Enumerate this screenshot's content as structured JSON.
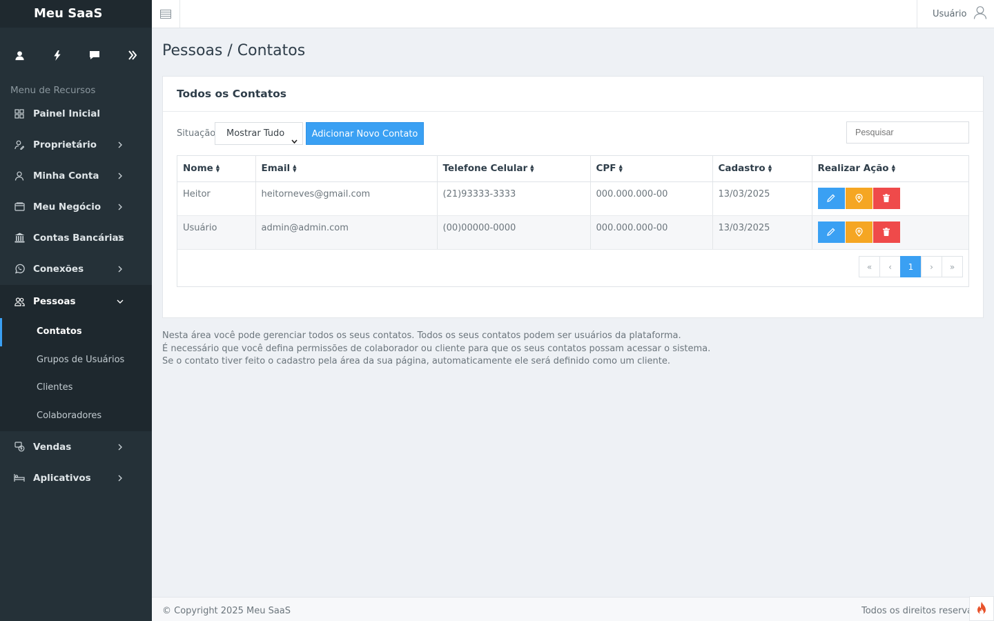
{
  "brand": "Meu SaaS",
  "sidebar": {
    "section_label": "Menu de Recursos",
    "items": [
      {
        "label": "Painel Inicial"
      },
      {
        "label": "Proprietário"
      },
      {
        "label": "Minha Conta"
      },
      {
        "label": "Meu Negócio"
      },
      {
        "label": "Contas Bancárias"
      },
      {
        "label": "Conexões"
      },
      {
        "label": "Pessoas"
      },
      {
        "label": "Vendas"
      },
      {
        "label": "Aplicativos"
      }
    ],
    "submenu": [
      {
        "label": "Contatos"
      },
      {
        "label": "Grupos de Usuários"
      },
      {
        "label": "Clientes"
      },
      {
        "label": "Colaboradores"
      }
    ]
  },
  "topbar": {
    "user_label": "Usuário"
  },
  "page": {
    "title": "Pessoas / Contatos",
    "card_title": "Todos os Contatos",
    "filter_label": "Situação",
    "filter_value": "Mostrar Tudo",
    "add_button": "Adicionar Novo Contato",
    "search_placeholder": "Pesquisar"
  },
  "table": {
    "columns": [
      "Nome",
      "Email",
      "Telefone Celular",
      "CPF",
      "Cadastro",
      "Realizar Ação"
    ],
    "rows": [
      {
        "nome": "Heitor",
        "email": "heitorneves@gmail.com",
        "telefone": "(21)93333-3333",
        "cpf": "000.000.000-00",
        "cadastro": "13/03/2025"
      },
      {
        "nome": "Usuário",
        "email": "admin@admin.com",
        "telefone": "(00)00000-0000",
        "cpf": "000.000.000-00",
        "cadastro": "13/03/2025"
      }
    ]
  },
  "pagination": {
    "first": "«",
    "prev": "‹",
    "current": "1",
    "next": "›",
    "last": "»"
  },
  "info_lines": [
    "Nesta área você pode gerenciar todos os seus contatos. Todos os seus contatos podem ser usuários da plataforma.",
    "É necessário que você defina permissões de colaborador ou cliente para que os seus contatos possam acessar o sistema.",
    "Se o contato tiver feito o cadastro pela área da sua página, automaticamente ele será definido como um cliente."
  ],
  "footer": {
    "copyright": "© Copyright 2025 Meu SaaS",
    "rights": "Todos os direitos reservados"
  },
  "colors": {
    "accent": "#3aa0f3",
    "warning": "#f5a623",
    "danger": "#ef4a4a",
    "sidebar": "#253138"
  }
}
